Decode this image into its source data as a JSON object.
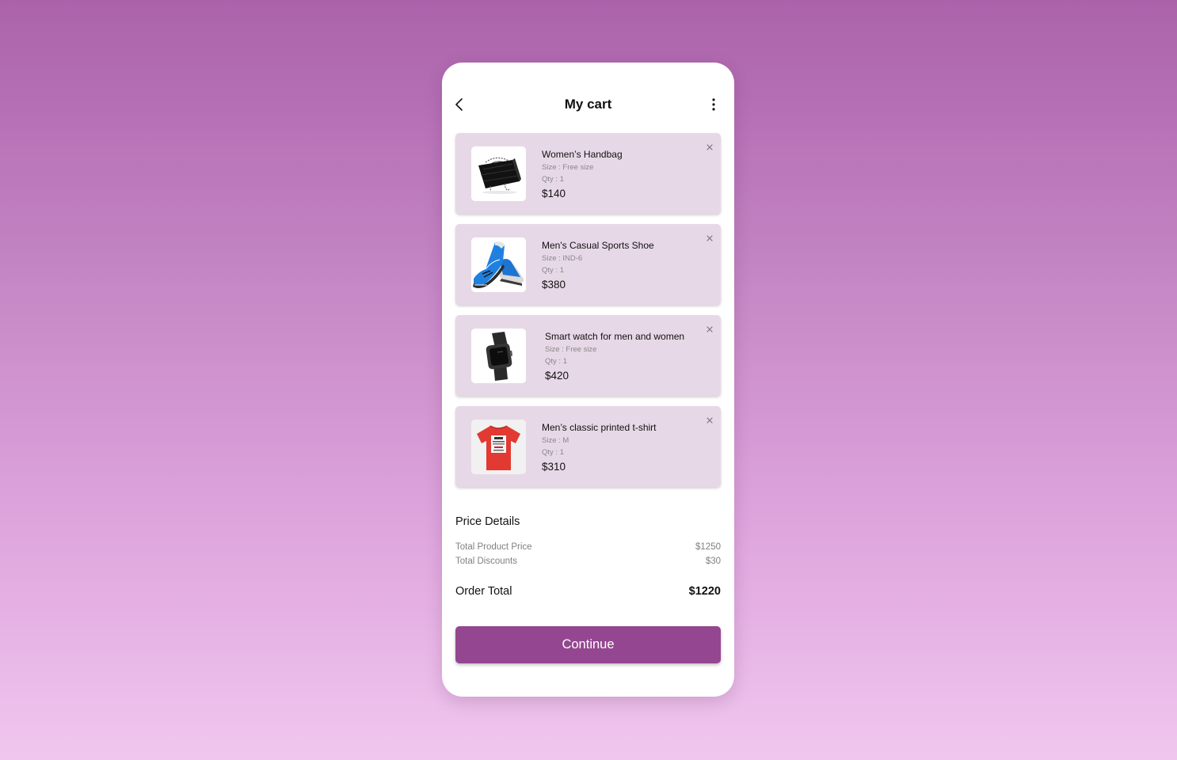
{
  "header": {
    "title": "My cart",
    "back_icon": "chevron-left-icon",
    "menu_icon": "more-vertical-icon"
  },
  "cart": {
    "items": [
      {
        "name": "Women’s Handbag",
        "size": "Size : Free size",
        "qty": "Qty : 1",
        "price": "$140",
        "image": "handbag"
      },
      {
        "name": "Men's Casual Sports Shoe",
        "size": "Size : IND-6",
        "qty": "Qty : 1",
        "price": "$380",
        "image": "sports-shoe"
      },
      {
        "name": "Smart watch for men and women",
        "size": "Size : Free size",
        "qty": "Qty : 1",
        "price": "$420",
        "image": "smart-watch"
      },
      {
        "name": "Men’s classic printed t-shirt",
        "size": "Size : M",
        "qty": "Qty : 1",
        "price": "$310",
        "image": "t-shirt"
      }
    ]
  },
  "price_details": {
    "title": "Price Details",
    "total_product_price_label": "Total Product Price",
    "total_product_price_value": "$1250",
    "total_discounts_label": "Total Discounts",
    "total_discounts_value": "$30",
    "order_total_label": "Order Total",
    "order_total_value": "$1220"
  },
  "actions": {
    "continue_label": "Continue"
  },
  "colors": {
    "accent": "#944790",
    "card_background": "#e7d8e7",
    "page_gradient_top": "#ab62aa",
    "page_gradient_bottom": "#f0c6ee"
  }
}
